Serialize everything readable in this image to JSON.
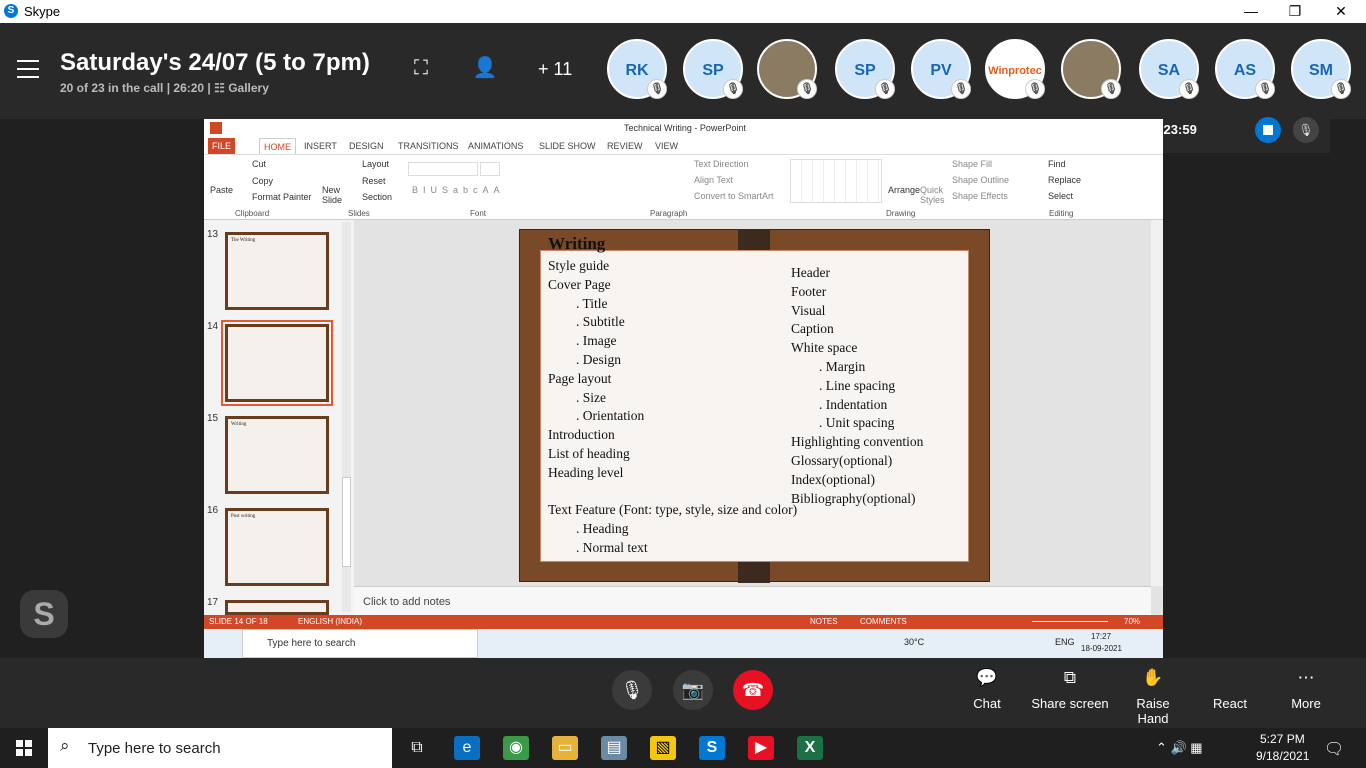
{
  "titlebar": {
    "app": "Skype",
    "min": "—",
    "max": "❐",
    "close": "✕"
  },
  "call": {
    "title": "Saturday's 24/07 (5 to 7pm)",
    "subtitle": "20 of 23 in the call | 26:20 | ☷ Gallery",
    "more_count": "+ 11",
    "participants": [
      {
        "label": "RK"
      },
      {
        "label": "SP"
      },
      {
        "label": ""
      },
      {
        "label": "SP"
      },
      {
        "label": "PV"
      },
      {
        "label": "Winprotec"
      },
      {
        "label": ""
      },
      {
        "label": "SA"
      },
      {
        "label": "AS"
      },
      {
        "label": "SM"
      }
    ],
    "recording_time": "0:23:59"
  },
  "ppt": {
    "window_title": "Technical Writing - PowerPoint",
    "tabs": [
      "FILE",
      "HOME",
      "INSERT",
      "DESIGN",
      "TRANSITIONS",
      "ANIMATIONS",
      "SLIDE SHOW",
      "REVIEW",
      "VIEW"
    ],
    "groups": {
      "clipboard": "Clipboard",
      "slides": "Slides",
      "font": "Font",
      "paragraph": "Paragraph",
      "drawing": "Drawing",
      "editing": "Editing"
    },
    "clipboard": {
      "paste": "Paste",
      "cut": "Cut",
      "copy": "Copy",
      "format_painter": "Format Painter"
    },
    "slides_grp": {
      "new_slide": "New Slide",
      "layout": "Layout",
      "reset": "Reset",
      "section": "Section"
    },
    "paragraph": {
      "text_direction": "Text Direction",
      "align_text": "Align Text",
      "smartart": "Convert to SmartArt"
    },
    "drawing": {
      "arrange": "Arrange",
      "quick_styles": "Quick Styles",
      "shape_fill": "Shape Fill",
      "shape_outline": "Shape Outline",
      "shape_effects": "Shape Effects"
    },
    "editing": {
      "find": "Find",
      "replace": "Replace",
      "select": "Select"
    },
    "thumbs": [
      "13",
      "14",
      "15",
      "16",
      "17"
    ],
    "thumb_titles": [
      "The Writing",
      "",
      "Writing",
      "Post writing",
      ""
    ],
    "slide_title": "Writing",
    "left_col": [
      "Style guide",
      "Cover Page",
      ". Title",
      ". Subtitle",
      ". Image",
      ". Design",
      "Page layout",
      ". Size",
      ". Orientation",
      "Introduction",
      "List of  heading",
      "Heading level",
      "",
      "Text Feature (Font: type, style, size and color)",
      ". Heading",
      ". Normal text"
    ],
    "right_col": [
      "Header",
      "Footer",
      "Visual",
      "Caption",
      "White space",
      ". Margin",
      ". Line spacing",
      ". Indentation",
      ". Unit spacing",
      "Highlighting convention",
      "Glossary(optional)",
      "Index(optional)",
      "Bibliography(optional)"
    ],
    "notes_placeholder": "Click to add notes",
    "status": {
      "slide": "SLIDE 14 OF 18",
      "lang": "ENGLISH (INDIA)",
      "notes": "NOTES",
      "comments": "COMMENTS",
      "zoom": "70%"
    },
    "inner_task": {
      "search": "Type here to search",
      "temp": "30°C",
      "lang": "ENG",
      "time": "17:27",
      "date": "18-09-2021"
    }
  },
  "controls": {
    "chat": "Chat",
    "share": "Share screen",
    "raise": "Raise Hand",
    "react": "React",
    "more": "More"
  },
  "taskbar": {
    "search": "Type here to search",
    "time": "5:27 PM",
    "date": "9/18/2021"
  }
}
